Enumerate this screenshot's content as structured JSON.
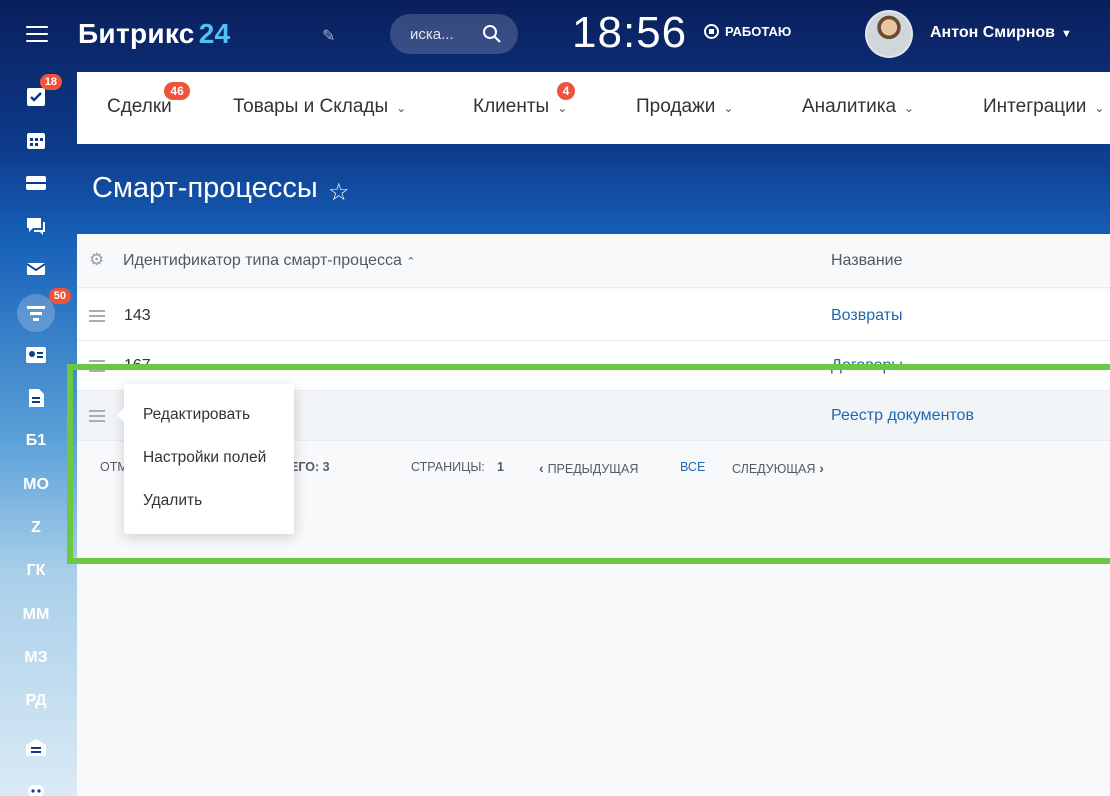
{
  "header": {
    "logo_text": "Битрикс",
    "logo_number": "24",
    "search_placeholder": "иска...",
    "clock": "18:56",
    "status": "РАБОТАЮ",
    "user_name": "Антон Смирнов"
  },
  "sidebar": {
    "tasks_badge": "18",
    "filter_badge": "50",
    "text_items": [
      "Б1",
      "МО",
      "Z",
      "ГК",
      "ММ",
      "МЗ",
      "РД"
    ]
  },
  "nav": {
    "items": [
      {
        "label": "Сделки",
        "badge": "46"
      },
      {
        "label": "Товары и Склады"
      },
      {
        "label": "Клиенты",
        "badge": "4"
      },
      {
        "label": "Продажи"
      },
      {
        "label": "Аналитика"
      },
      {
        "label": "Интеграции"
      }
    ]
  },
  "page": {
    "title": "Смарт-процессы"
  },
  "grid": {
    "columns": [
      "Идентификатор типа смарт-процесса",
      "Название"
    ],
    "rows": [
      {
        "id": "143",
        "name": "Возвраты"
      },
      {
        "id": "167",
        "name": "Договоры"
      },
      {
        "id": "",
        "name": "Реестр документов"
      }
    ],
    "footer": {
      "marked": "ОТМ",
      "total": "ЕГО: 3",
      "pages_label": "СТРАНИЦЫ:",
      "pages_value": "1",
      "prev": "ПРЕДЫДУЩАЯ",
      "all": "ВСЕ",
      "next": "СЛЕДУЮЩАЯ"
    }
  },
  "context_menu": {
    "items": [
      "Редактировать",
      "Настройки полей",
      "Удалить"
    ]
  },
  "colors": {
    "highlight": "#6cc93f",
    "link": "#2067b0",
    "badge": "#f0523c"
  }
}
